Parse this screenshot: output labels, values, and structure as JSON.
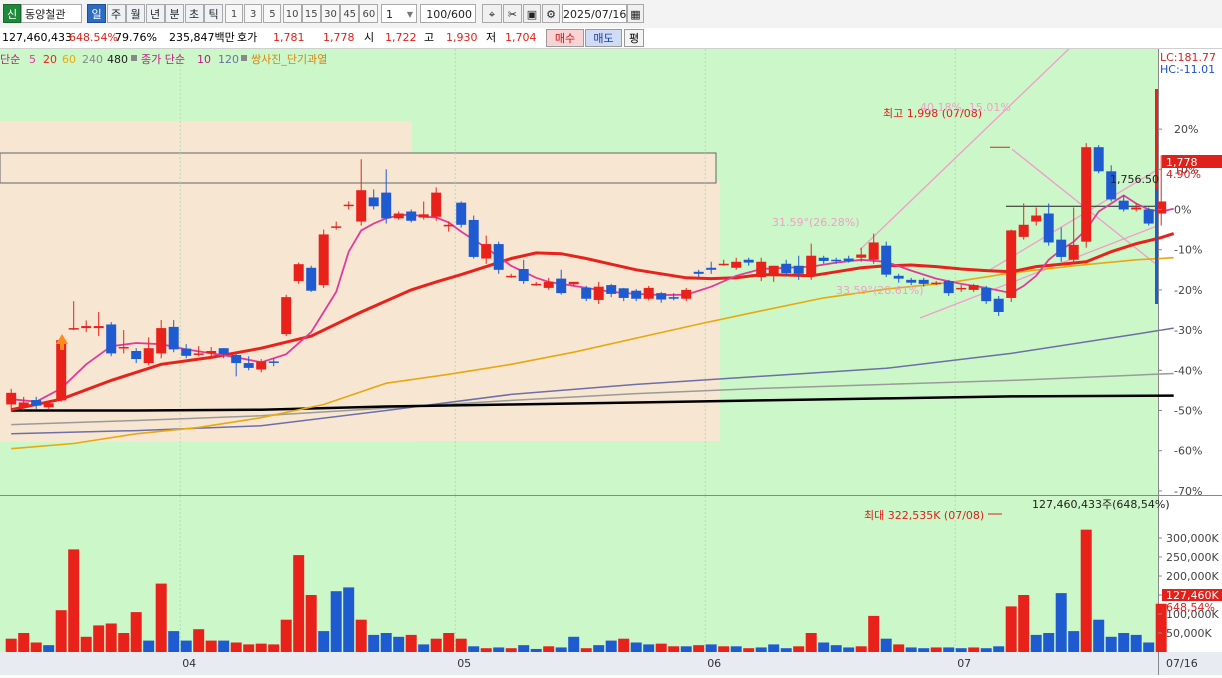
{
  "toolbar": {
    "market_badge": "신",
    "stock_name": "동양철관",
    "periods": [
      "일",
      "주",
      "월",
      "년",
      "분",
      "초",
      "틱"
    ],
    "active_period": "일",
    "intervals": [
      "1",
      "3",
      "5",
      "10",
      "15",
      "30",
      "45",
      "60"
    ],
    "interval_select": "1",
    "count_value": "100/600",
    "date_value": "2025/07/16"
  },
  "quote": {
    "volume": "127,460,433",
    "volume_ratio": "648.54%",
    "turnover_pct": "79.76%",
    "amount": "235,847백만",
    "ask_label": "호가",
    "ask_price": "1,781",
    "bid_price": "1,778",
    "open_label": "시",
    "open_price": "1,722",
    "high_label": "고",
    "high_price": "1,930",
    "low_label": "저",
    "low_price": "1,704",
    "buy_label": "매수",
    "sell_label": "매도",
    "avg_label": "평"
  },
  "legend": {
    "ma_label": "단순",
    "ma_periods": [
      "5",
      "20",
      "60",
      "240",
      "480"
    ],
    "vol_label": "종가 단순",
    "vol_periods": [
      "10",
      "120"
    ],
    "pattern_label": "쌍사진_단기과열"
  },
  "colors": {
    "up": "#e8221b",
    "down": "#1e5bd0",
    "ma5": "#e23a9c",
    "ma20": "#e8221b",
    "ma60": "#e8a80e",
    "ma240": "#6e6ea8",
    "ma480": "#000000",
    "bg": "#ccf7c8",
    "zone": "#f7e6d2"
  },
  "chart_data": {
    "type": "candlestick",
    "y_axis_unit": "%",
    "y_ticks": [
      "20%",
      "10%",
      "0%",
      "-10%",
      "-20%",
      "-30%",
      "-40%",
      "-50%",
      "-60%",
      "-70%"
    ],
    "lc": "LC:181.77",
    "hc": "HC:-11.01",
    "current_price": "1,778",
    "current_change": "4.90%",
    "trend_value": "1,756.50",
    "high_annotation": "최고 1,998 (07/08)",
    "high_pct_annotation": "40.18%, 15.01%",
    "mid_annotation": "31.59°(26.28%)",
    "low_annotation": "33.59°(28.61%)",
    "x_ticks": [
      "04",
      "05",
      "06",
      "07",
      "07/16"
    ],
    "candles": [
      [
        -48.5,
        -45.6,
        -50,
        -44.6
      ],
      [
        -49.3,
        -48,
        -50,
        -46.6
      ],
      [
        -47.4,
        -48.8,
        -49.6,
        -46.6
      ],
      [
        -49.2,
        -48.2,
        -49.6,
        -47.6
      ],
      [
        -47.5,
        -32.5,
        -47.8,
        -32
      ],
      [
        -29.5,
        -29.5,
        -30,
        -22.8
      ],
      [
        -29.5,
        -29,
        -30.5,
        -27.6
      ],
      [
        -29.5,
        -29,
        -31.5,
        -25.5
      ],
      [
        -28.6,
        -35.8,
        -36.5,
        -28
      ],
      [
        -34.2,
        -34.2,
        -35.8,
        -30
      ],
      [
        -35.2,
        -37.2,
        -38.2,
        -34.5
      ],
      [
        -38.2,
        -34.5,
        -38.8,
        -31.8
      ],
      [
        -35.8,
        -29.5,
        -37,
        -27.5
      ],
      [
        -29.2,
        -34.8,
        -35.5,
        -27.5
      ],
      [
        -34.6,
        -36.4,
        -37,
        -33.5
      ],
      [
        -35.8,
        -35.8,
        -36.5,
        -34
      ],
      [
        -35.8,
        -35.2,
        -36.5,
        -34.2
      ],
      [
        -34.5,
        -36,
        -37,
        -34.5
      ],
      [
        -36.2,
        -38.2,
        -41.5,
        -35.8
      ],
      [
        -38.2,
        -39.4,
        -40,
        -36.5
      ],
      [
        -39.8,
        -37.8,
        -40.5,
        -37.2
      ],
      [
        -37.8,
        -38,
        -39,
        -37
      ],
      [
        -31,
        -21.8,
        -31.5,
        -21.2
      ],
      [
        -17.8,
        -13.6,
        -18.5,
        -13.2
      ],
      [
        -14.5,
        -20.2,
        -20.5,
        -14
      ],
      [
        -18.8,
        -6.2,
        -19.5,
        -5
      ],
      [
        -4.2,
        -4.2,
        -5,
        -3
      ],
      [
        1.2,
        1.2,
        0,
        2
      ],
      [
        -3,
        4.8,
        -4,
        12.5
      ],
      [
        3,
        0.8,
        0,
        5
      ],
      [
        4.2,
        -2.2,
        -3.5,
        10
      ],
      [
        -2.2,
        -1,
        -2.5,
        -0.5
      ],
      [
        -0.5,
        -2.8,
        -3.2,
        0
      ],
      [
        -2,
        -1.2,
        -2.5,
        2
      ],
      [
        -1.8,
        4.2,
        -2.8,
        5.5
      ],
      [
        -4.2,
        -3.8,
        -5.5,
        -3
      ],
      [
        1.7,
        -3.8,
        -4.5,
        2
      ],
      [
        -2.6,
        -11.8,
        -12.2,
        -1.5
      ],
      [
        -12.2,
        -8.6,
        -13.5,
        -6.5
      ],
      [
        -8.6,
        -15,
        -16,
        -8
      ],
      [
        -16.5,
        -16.5,
        -17,
        -16
      ],
      [
        -14.8,
        -17.8,
        -18.5,
        -12.5
      ],
      [
        -18.5,
        -18.5,
        -19,
        -18
      ],
      [
        -19.5,
        -18,
        -20,
        -17
      ],
      [
        -17.2,
        -20.8,
        -21.2,
        -15
      ],
      [
        -18.6,
        -18,
        -19,
        -18
      ],
      [
        -19.5,
        -22.2,
        -22.8,
        -19
      ],
      [
        -22.5,
        -19.2,
        -23.5,
        -18
      ],
      [
        -18.8,
        -21,
        -21.8,
        -18.5
      ],
      [
        -19.6,
        -22,
        -22.8,
        -19.5
      ],
      [
        -20.2,
        -22.2,
        -22.8,
        -19.8
      ],
      [
        -22.2,
        -19.5,
        -22.6,
        -19
      ],
      [
        -20.8,
        -22.4,
        -23.2,
        -20.5
      ],
      [
        -21.8,
        -22.2,
        -22.6,
        -20.8
      ],
      [
        -22.2,
        -20,
        -22.8,
        -19.5
      ],
      [
        -15.5,
        -16,
        -16.8,
        -15
      ],
      [
        -14.5,
        -15,
        -16,
        -13
      ],
      [
        -13.5,
        -13.5,
        -14,
        -12.5
      ],
      [
        -14.5,
        -13,
        -15,
        -12
      ],
      [
        -12.5,
        -13.2,
        -14,
        -12
      ],
      [
        -16.8,
        -13,
        -17.8,
        -12
      ],
      [
        -16,
        -14,
        -18,
        -14
      ],
      [
        -13.5,
        -15.8,
        -16.5,
        -12.5
      ],
      [
        -14,
        -16,
        -17.5,
        -11.5
      ],
      [
        -16.5,
        -11.5,
        -17.5,
        -8.5
      ],
      [
        -12,
        -12.8,
        -13.5,
        -11.5
      ],
      [
        -12.5,
        -12.8,
        -13.5,
        -12
      ],
      [
        -12.2,
        -12.8,
        -13.2,
        -11.5
      ],
      [
        -12,
        -11.2,
        -13,
        -9.5
      ],
      [
        -12.5,
        -8.2,
        -13.5,
        -6
      ],
      [
        -9,
        -16.2,
        -16.8,
        -8
      ],
      [
        -16.5,
        -17.2,
        -18.2,
        -16
      ],
      [
        -17.5,
        -18.2,
        -18.8,
        -17
      ],
      [
        -17.5,
        -18.5,
        -19.2,
        -17
      ],
      [
        -18.2,
        -18.2,
        -18.8,
        -17.8
      ],
      [
        -17.8,
        -20.8,
        -21.5,
        -17.5
      ],
      [
        -19.5,
        -19.5,
        -20.5,
        -18.8
      ],
      [
        -20,
        -18.8,
        -20.5,
        -18.5
      ],
      [
        -19.5,
        -22.8,
        -23.5,
        -19
      ],
      [
        -22.2,
        -25.5,
        -26.5,
        -21.5
      ],
      [
        -22,
        -5.2,
        -23,
        -5
      ],
      [
        -6.8,
        -3.8,
        -7.5,
        1.5
      ],
      [
        -3,
        -1.5,
        -4,
        0.5
      ],
      [
        -1,
        -8.2,
        -9,
        1.5
      ],
      [
        -7.5,
        -11.8,
        -13,
        -4.5
      ],
      [
        -12.5,
        -8.8,
        -13,
        0.5
      ],
      [
        -8,
        15.5,
        -9.5,
        16.5
      ],
      [
        15.5,
        9.5,
        9,
        16
      ],
      [
        9.5,
        2.5,
        2,
        11
      ],
      [
        2.2,
        0,
        -0.5,
        3.5
      ],
      [
        0,
        0.5,
        -0.5,
        1.5
      ],
      [
        0,
        -3.5,
        -4,
        0.5
      ],
      [
        -1,
        2,
        -4,
        13.5
      ]
    ],
    "ma5": [
      [
        0,
        -47.2
      ],
      [
        2,
        -47.8
      ],
      [
        4,
        -44.5
      ],
      [
        6,
        -38.5
      ],
      [
        8,
        -34
      ],
      [
        10,
        -33.2
      ],
      [
        12,
        -33.5
      ],
      [
        14,
        -34.8
      ],
      [
        16,
        -35.8
      ],
      [
        18,
        -36.8
      ],
      [
        20,
        -38
      ],
      [
        22,
        -36
      ],
      [
        24,
        -30.5
      ],
      [
        25,
        -25.5
      ],
      [
        26,
        -20.5
      ],
      [
        27,
        -10.5
      ],
      [
        28,
        -5.2
      ],
      [
        29,
        -3.5
      ],
      [
        30,
        -2.2
      ],
      [
        31,
        -1.5
      ],
      [
        32,
        -1.2
      ],
      [
        33,
        -1.8
      ],
      [
        34,
        -2
      ],
      [
        35,
        -3.2
      ],
      [
        36,
        -5.5
      ],
      [
        37,
        -7.5
      ],
      [
        38,
        -9.5
      ],
      [
        39,
        -11.8
      ],
      [
        40,
        -14
      ],
      [
        41,
        -15.5
      ],
      [
        42,
        -17
      ],
      [
        43,
        -18
      ],
      [
        44,
        -18.5
      ],
      [
        46,
        -19.5
      ],
      [
        48,
        -20.5
      ],
      [
        50,
        -21
      ],
      [
        52,
        -21.3
      ],
      [
        54,
        -21.2
      ],
      [
        56,
        -19.2
      ],
      [
        58,
        -16.5
      ],
      [
        60,
        -14.8
      ],
      [
        62,
        -14.5
      ],
      [
        64,
        -14.2
      ],
      [
        66,
        -13.2
      ],
      [
        68,
        -12.5
      ],
      [
        70,
        -13
      ],
      [
        72,
        -15.2
      ],
      [
        74,
        -17.2
      ],
      [
        76,
        -18.5
      ],
      [
        78,
        -19.5
      ],
      [
        80,
        -20.8
      ],
      [
        81,
        -19
      ],
      [
        82,
        -16.5
      ],
      [
        83,
        -12.5
      ],
      [
        84,
        -10
      ],
      [
        85,
        -8
      ],
      [
        86,
        -5
      ],
      [
        87,
        -0.5
      ],
      [
        88,
        1.5
      ],
      [
        89,
        3.5
      ],
      [
        90,
        1.5
      ],
      [
        91,
        0
      ],
      [
        92,
        -0.5
      ],
      [
        93,
        0.2
      ]
    ],
    "ma20": [
      [
        0,
        -49.8
      ],
      [
        4,
        -47.2
      ],
      [
        8,
        -42.5
      ],
      [
        12,
        -38.5
      ],
      [
        16,
        -36.8
      ],
      [
        20,
        -34.5
      ],
      [
        24,
        -31.5
      ],
      [
        28,
        -25.5
      ],
      [
        32,
        -20
      ],
      [
        34,
        -18
      ],
      [
        36,
        -16.2
      ],
      [
        38,
        -14.2
      ],
      [
        40,
        -12.2
      ],
      [
        42,
        -10.8
      ],
      [
        44,
        -11
      ],
      [
        46,
        -12.2
      ],
      [
        48,
        -13.6
      ],
      [
        50,
        -15
      ],
      [
        52,
        -16
      ],
      [
        54,
        -17
      ],
      [
        56,
        -17.2
      ],
      [
        58,
        -17
      ],
      [
        60,
        -16.2
      ],
      [
        62,
        -16.3
      ],
      [
        64,
        -16.5
      ],
      [
        66,
        -15.5
      ],
      [
        68,
        -14.5
      ],
      [
        70,
        -14
      ],
      [
        72,
        -13.8
      ],
      [
        74,
        -14.2
      ],
      [
        76,
        -14.8
      ],
      [
        78,
        -15.2
      ],
      [
        80,
        -15.5
      ],
      [
        82,
        -14.2
      ],
      [
        84,
        -13.6
      ],
      [
        86,
        -13
      ],
      [
        88,
        -10.5
      ],
      [
        90,
        -8.5
      ],
      [
        92,
        -7
      ],
      [
        93,
        -6
      ]
    ],
    "ma60": [
      [
        0,
        -59.5
      ],
      [
        5,
        -58.2
      ],
      [
        10,
        -55.8
      ],
      [
        15,
        -54.2
      ],
      [
        20,
        -51.8
      ],
      [
        25,
        -48.5
      ],
      [
        30,
        -43.2
      ],
      [
        35,
        -41
      ],
      [
        40,
        -38.5
      ],
      [
        45,
        -35.5
      ],
      [
        50,
        -32
      ],
      [
        55,
        -28.5
      ],
      [
        60,
        -25.2
      ],
      [
        65,
        -22
      ],
      [
        70,
        -19.8
      ],
      [
        75,
        -18.2
      ],
      [
        80,
        -15.8
      ],
      [
        85,
        -14
      ],
      [
        90,
        -12.5
      ],
      [
        93,
        -12
      ]
    ],
    "ma240": [
      [
        0,
        -55.8
      ],
      [
        10,
        -55
      ],
      [
        20,
        -53.8
      ],
      [
        30,
        -50
      ],
      [
        40,
        -46
      ],
      [
        50,
        -43.5
      ],
      [
        60,
        -41.5
      ],
      [
        70,
        -39.5
      ],
      [
        80,
        -35.8
      ],
      [
        90,
        -31
      ],
      [
        93,
        -29.5
      ]
    ],
    "ma480": [
      [
        0,
        -53.5
      ],
      [
        10,
        -52.5
      ],
      [
        20,
        -51.3
      ],
      [
        30,
        -49.4
      ],
      [
        40,
        -47.5
      ],
      [
        50,
        -45.8
      ],
      [
        60,
        -44.5
      ],
      [
        70,
        -43.5
      ],
      [
        80,
        -42.5
      ],
      [
        90,
        -41.2
      ],
      [
        93,
        -40.8
      ]
    ],
    "ma_black": [
      [
        0,
        -50
      ],
      [
        10,
        -50
      ],
      [
        20,
        -49.8
      ],
      [
        30,
        -49
      ],
      [
        40,
        -48.5
      ],
      [
        50,
        -48
      ],
      [
        60,
        -47.5
      ],
      [
        70,
        -47
      ],
      [
        80,
        -46.5
      ],
      [
        93,
        -46.3
      ]
    ],
    "volume_ticks": [
      "300,000K",
      "250,000K",
      "200,000K",
      "150,000K",
      "100,000K",
      "50,000K"
    ],
    "volume_max_annotation": "최대 322,535K (07/08)",
    "volume_total_annotation": "127,460,433주(648,54%)",
    "volume_current": "127,460K",
    "volume_current_pct": "648,54%",
    "volume": [
      [
        35,
        1
      ],
      [
        50,
        1
      ],
      [
        25,
        1
      ],
      [
        18,
        0
      ],
      [
        110,
        1
      ],
      [
        270,
        1
      ],
      [
        40,
        1
      ],
      [
        70,
        1
      ],
      [
        75,
        1
      ],
      [
        50,
        1
      ],
      [
        105,
        1
      ],
      [
        30,
        0
      ],
      [
        180,
        1
      ],
      [
        55,
        0
      ],
      [
        30,
        0
      ],
      [
        60,
        1
      ],
      [
        30,
        1
      ],
      [
        30,
        0
      ],
      [
        25,
        1
      ],
      [
        20,
        1
      ],
      [
        22,
        1
      ],
      [
        20,
        1
      ],
      [
        85,
        1
      ],
      [
        255,
        1
      ],
      [
        150,
        1
      ],
      [
        55,
        0
      ],
      [
        160,
        0
      ],
      [
        170,
        0
      ],
      [
        85,
        1
      ],
      [
        45,
        0
      ],
      [
        50,
        0
      ],
      [
        40,
        0
      ],
      [
        45,
        1
      ],
      [
        20,
        0
      ],
      [
        35,
        1
      ],
      [
        50,
        1
      ],
      [
        35,
        1
      ],
      [
        15,
        0
      ],
      [
        10,
        1
      ],
      [
        12,
        0
      ],
      [
        10,
        1
      ],
      [
        18,
        0
      ],
      [
        8,
        0
      ],
      [
        15,
        1
      ],
      [
        12,
        0
      ],
      [
        40,
        0
      ],
      [
        10,
        1
      ],
      [
        18,
        0
      ],
      [
        30,
        0
      ],
      [
        35,
        1
      ],
      [
        25,
        0
      ],
      [
        20,
        0
      ],
      [
        22,
        1
      ],
      [
        15,
        1
      ],
      [
        15,
        0
      ],
      [
        18,
        1
      ],
      [
        20,
        0
      ],
      [
        15,
        1
      ],
      [
        15,
        0
      ],
      [
        10,
        1
      ],
      [
        12,
        0
      ],
      [
        20,
        0
      ],
      [
        10,
        0
      ],
      [
        15,
        1
      ],
      [
        50,
        1
      ],
      [
        25,
        0
      ],
      [
        18,
        0
      ],
      [
        12,
        0
      ],
      [
        15,
        1
      ],
      [
        95,
        1
      ],
      [
        35,
        0
      ],
      [
        20,
        1
      ],
      [
        12,
        0
      ],
      [
        10,
        0
      ],
      [
        12,
        1
      ],
      [
        12,
        0
      ],
      [
        10,
        0
      ],
      [
        12,
        1
      ],
      [
        10,
        0
      ],
      [
        15,
        0
      ],
      [
        120,
        1
      ],
      [
        150,
        1
      ],
      [
        45,
        0
      ],
      [
        50,
        0
      ],
      [
        155,
        0
      ],
      [
        55,
        0
      ],
      [
        322,
        1
      ],
      [
        85,
        0
      ],
      [
        40,
        0
      ],
      [
        50,
        0
      ],
      [
        45,
        0
      ],
      [
        25,
        0
      ],
      [
        127,
        1
      ]
    ]
  }
}
